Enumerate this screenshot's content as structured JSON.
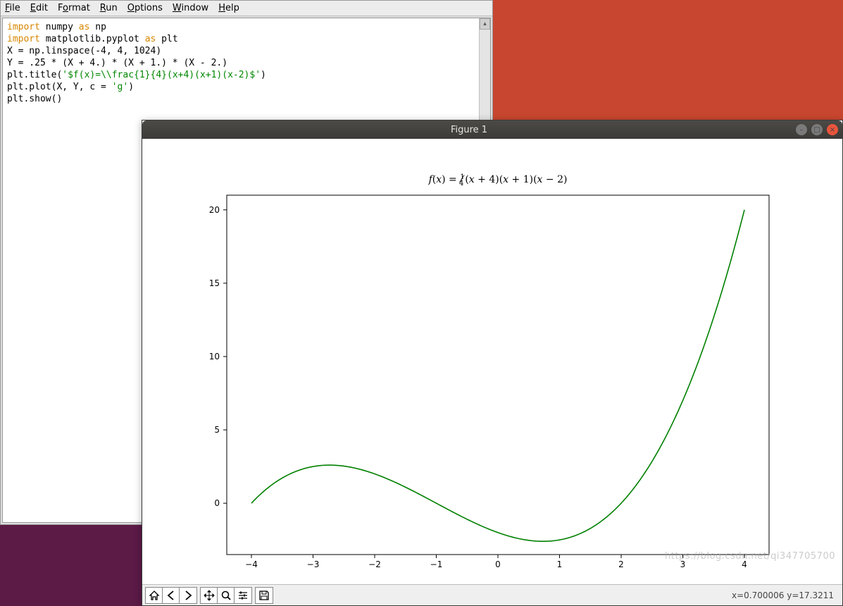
{
  "menubar": {
    "items": [
      "File",
      "Edit",
      "Format",
      "Run",
      "Options",
      "Window",
      "Help"
    ]
  },
  "editor": {
    "code_tokens": [
      [
        [
          "kw",
          "import"
        ],
        [
          "",
          " numpy "
        ],
        [
          "kw",
          "as"
        ],
        [
          "",
          " np"
        ]
      ],
      [
        [
          "kw",
          "import"
        ],
        [
          "",
          " matplotlib.pyplot "
        ],
        [
          "kw",
          "as"
        ],
        [
          "",
          " plt"
        ]
      ],
      [
        [
          "",
          "X = np.linspace(-4, 4, 1024)"
        ]
      ],
      [
        [
          "",
          "Y = .25 * (X + 4.) * (X + 1.) * (X - 2.)"
        ]
      ],
      [
        [
          "",
          "plt.title("
        ],
        [
          "str",
          "'$f(x)=\\\\frac{1}{4}(x+4)(x+1)(x-2)$'"
        ],
        [
          "",
          ")"
        ]
      ],
      [
        [
          "",
          "plt.plot(X, Y, c = "
        ],
        [
          "str",
          "'g'"
        ],
        [
          "",
          ")"
        ]
      ],
      [
        [
          "",
          "plt.show()"
        ]
      ]
    ]
  },
  "figure": {
    "title": "Figure 1",
    "coords": "x=0.700006   y=17.3211",
    "toolbar": {
      "home": "⌂",
      "back": "🠔",
      "forward": "🠖",
      "pan": "✥",
      "zoom": "🔍",
      "configure": "≡",
      "save": "💾"
    }
  },
  "watermark": "https://blog.csdn.net/qi347705700",
  "chart_data": {
    "type": "line",
    "title": "f(x) = ¼(x + 4)(x + 1)(x − 2)",
    "xlabel": "",
    "ylabel": "",
    "xlim": [
      -4.4,
      4.4
    ],
    "ylim": [
      -3.5,
      21
    ],
    "xticks": [
      -4,
      -3,
      -2,
      -1,
      0,
      1,
      2,
      3,
      4
    ],
    "yticks": [
      0,
      5,
      10,
      15,
      20
    ],
    "series": [
      {
        "name": "f(x)",
        "color": "#008000",
        "formula": "0.25*(x+4)*(x+1)*(x-2)",
        "x_domain": [
          -4,
          4
        ],
        "n_points": 1024
      }
    ]
  }
}
